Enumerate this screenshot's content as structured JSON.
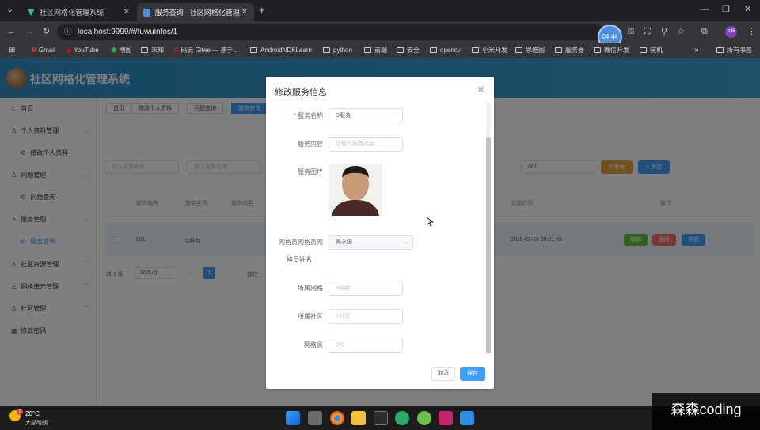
{
  "browser": {
    "tabs": [
      {
        "title": "社区网格化管理系统",
        "active": false
      },
      {
        "title": "服务查询 - 社区网格化管理系统",
        "active": true
      }
    ],
    "url": "localhost:9999/#/fuwuinfos/1",
    "timer": "04:44",
    "profile": "文辉",
    "bookmarks": [
      "Gmail",
      "YouTube",
      "地图",
      "未知",
      "码云 Gitee — 基于...",
      "AndroidNDKLearn",
      "python",
      "前端",
      "安全",
      "opencv",
      "小米开发",
      "思维图",
      "服务器",
      "微信开发",
      "装机"
    ],
    "all_bookmarks": "所有书签"
  },
  "app": {
    "title": "社区网格化管理系统",
    "sidebar": [
      {
        "label": "首页",
        "icon": "home-icon",
        "level": 1
      },
      {
        "label": "个人资料管理",
        "icon": "user-icon",
        "level": 1,
        "expanded": true
      },
      {
        "label": "修改个人资料",
        "icon": "gear-icon",
        "level": 2
      },
      {
        "label": "问题管理",
        "icon": "user-icon",
        "level": 1,
        "expanded": true
      },
      {
        "label": "问题查询",
        "icon": "gear-icon",
        "level": 2
      },
      {
        "label": "服务管理",
        "icon": "user-icon",
        "level": 1,
        "expanded": true
      },
      {
        "label": "服务查询",
        "icon": "gear-icon",
        "level": 2,
        "active": true
      },
      {
        "label": "社区资源管理",
        "icon": "user-icon",
        "level": 1
      },
      {
        "label": "网格单元管理",
        "icon": "user-icon",
        "level": 1
      },
      {
        "label": "社区管理",
        "icon": "user-icon",
        "level": 1
      },
      {
        "label": "修改密码",
        "icon": "grid-icon",
        "level": 1
      }
    ],
    "breadcrumbs": [
      "首页",
      "修改个人资料",
      "问题查询",
      "服务查询"
    ],
    "search": {
      "placeholder1": "输入服务编号",
      "placeholder2": "输入服务名称",
      "value3": "001",
      "search_label": "搜索",
      "add_label": "添加"
    },
    "table": {
      "headers": [
        "服务编号",
        "服务名称",
        "服务内容",
        "添加时间",
        "操作"
      ],
      "rows": [
        {
          "id": "001",
          "name": "D服务",
          "time": "2025-02-19 20:01:48",
          "actions": [
            "编辑",
            "删除",
            "详情"
          ]
        }
      ]
    },
    "pagination": {
      "total": "共 1 条",
      "page_size": "10条/页",
      "current_page": "1",
      "goto": "前往"
    }
  },
  "dialog": {
    "title": "修改服务信息",
    "fields": {
      "name_label": "服务名称",
      "name_value": "D服务",
      "content_label": "服务内容",
      "content_placeholder": "请输入服务内容",
      "image_label": "服务图片",
      "gridman_label_1": "网格员网格员网",
      "gridman_label_2": "格员姓名",
      "gridman_value": "吴永国",
      "grid_label": "所属网格",
      "grid_value": "H网格",
      "community_label": "所属社区",
      "community_value": "K社区",
      "gridman_id_label": "网格员",
      "gridman_id_value": "001"
    },
    "cancel_label": "取消",
    "save_label": "保存"
  },
  "taskbar": {
    "temperature": "20°C",
    "weather": "大部晴朗",
    "badge": "1"
  },
  "watermark": "森森coding",
  "colors": {
    "primary": "#409eff",
    "header": "#3396cb",
    "success": "#67c23a",
    "danger": "#f56c6c",
    "warning": "#e6a23c"
  }
}
